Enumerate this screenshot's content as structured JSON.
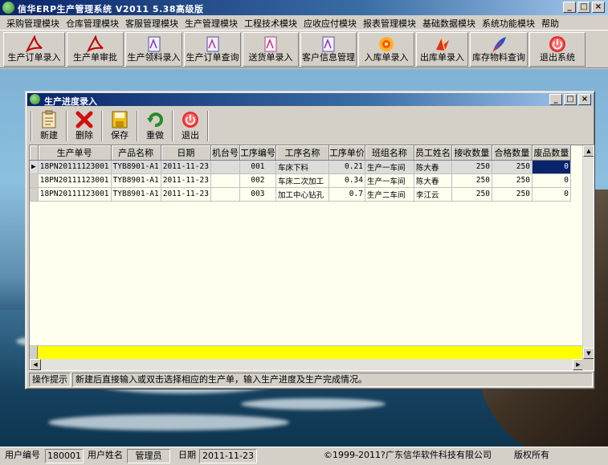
{
  "app": {
    "title": "信华ERP生产管理系统   V2011 5.38高级版",
    "window_buttons": [
      "_",
      "□",
      "×"
    ]
  },
  "menu": [
    "采购管理模块",
    "仓库管理模块",
    "客服管理模块",
    "生产管理模块",
    "工程技术模块",
    "应收应付模块",
    "报表管理模块",
    "基础数据模块",
    "系统功能模块",
    "帮助"
  ],
  "toolbar": [
    {
      "label": "生产订单录入",
      "icon": "pdf-icon"
    },
    {
      "label": "生产单审批",
      "icon": "pdf-icon"
    },
    {
      "label": "生产领料录入",
      "icon": "document-icon"
    },
    {
      "label": "生产订单查询",
      "icon": "document-icon"
    },
    {
      "label": "送货单录入",
      "icon": "document-icon"
    },
    {
      "label": "客户信息管理",
      "icon": "document-icon"
    },
    {
      "label": "入库单录入",
      "icon": "flower-icon"
    },
    {
      "label": "出库单录入",
      "icon": "bird-icon"
    },
    {
      "label": "库存物料查询",
      "icon": "feather-icon"
    },
    {
      "label": "退出系统",
      "icon": "power-icon"
    }
  ],
  "child_window": {
    "title": "生产进度录入",
    "buttons": [
      {
        "label": "新建",
        "icon": "new-document-icon"
      },
      {
        "label": "删除",
        "icon": "delete-x-icon"
      },
      {
        "label": "保存",
        "icon": "save-floppy-icon"
      },
      {
        "label": "重做",
        "icon": "redo-icon"
      },
      {
        "label": "退出",
        "icon": "exit-icon"
      }
    ],
    "grid": {
      "columns": [
        "生产单号",
        "产品名称",
        "日期",
        "机台号",
        "工序编号",
        "工序名称",
        "工序单价",
        "班组名称",
        "员工姓名",
        "接收数量",
        "合格数量",
        "废品数量"
      ],
      "rows": [
        [
          "18PN20111123001",
          "TYB8901-A1",
          "2011-11-23",
          "",
          "001",
          "车床下料",
          "0.21",
          "生产一车间",
          "陈大春",
          "250",
          "250",
          "0"
        ],
        [
          "18PN20111123001",
          "TYB8901-A1",
          "2011-11-23",
          "",
          "002",
          "车床二次加工",
          "0.34",
          "生产一车间",
          "陈大春",
          "250",
          "250",
          "0"
        ],
        [
          "18PN20111123001",
          "TYB8901-A1",
          "2011-11-23",
          "",
          "003",
          "加工中心钻孔",
          "0.7",
          "生产二车间",
          "李江云",
          "250",
          "250",
          "0"
        ]
      ]
    },
    "hint_label": "操作提示",
    "hint_text": "新建后直接输入或双击选择相应的生产单，输入生产进度及生产完成情况。"
  },
  "status": {
    "user_id_label": "用户编号",
    "user_id": "180001",
    "user_name_label": "用户姓名",
    "user_name": "管理员",
    "date_label": "日期",
    "date": "2011-11-23",
    "copyright": "©1999-2011?",
    "company": "广东信华软件科技有限公司",
    "rights": "版权所有"
  }
}
